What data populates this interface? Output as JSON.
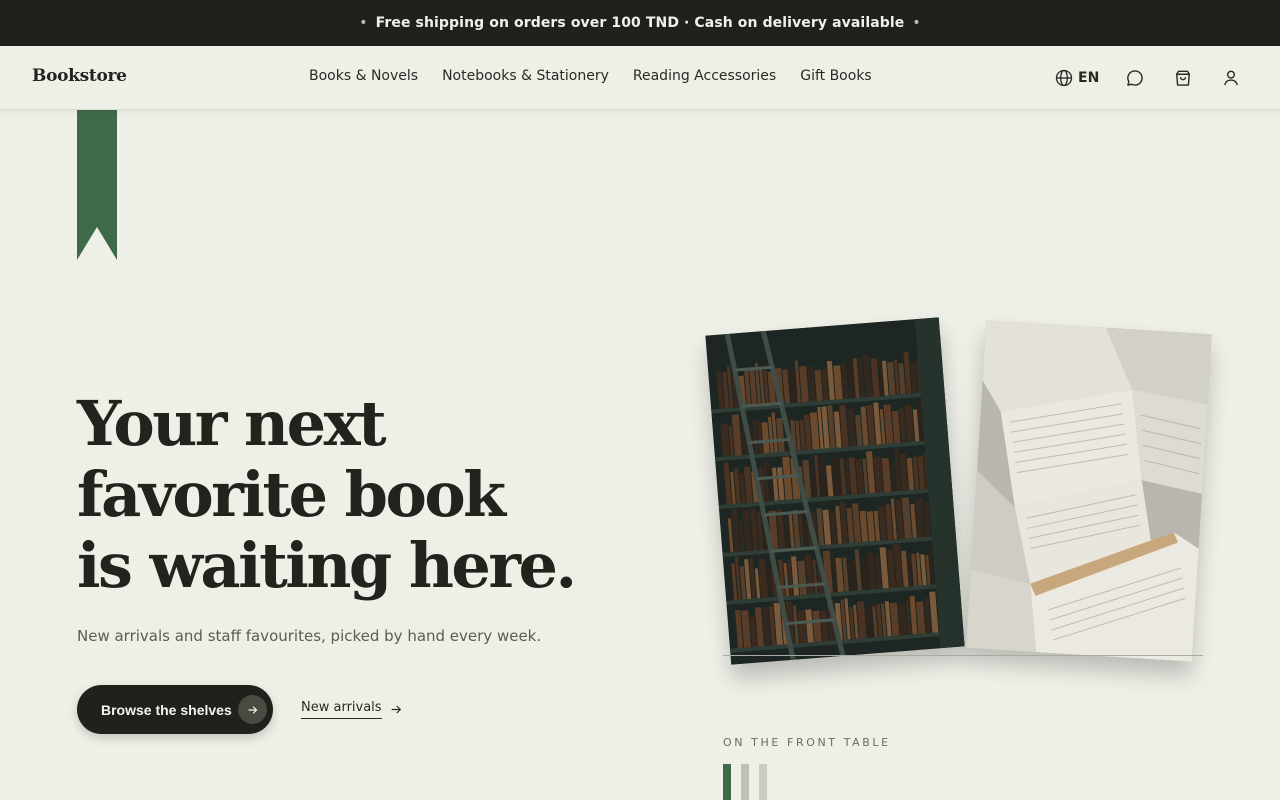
{
  "announcement": {
    "text": "Free shipping on orders over 100 TND · Cash on delivery available",
    "bullet": "•"
  },
  "nav": {
    "logo": "Bookstore",
    "items": [
      {
        "label": "Books & Novels"
      },
      {
        "label": "Notebooks & Stationery"
      },
      {
        "label": "Reading Accessories"
      },
      {
        "label": "Gift Books"
      }
    ],
    "language": "EN",
    "icons": [
      "globe-icon",
      "chat-icon",
      "shopping-bag-icon",
      "user-icon"
    ]
  },
  "hero": {
    "title_line1": "Your next",
    "title_line2": "favorite book",
    "title_line3": "is waiting here.",
    "subtitle": "New arrivals and staff favourites, picked by hand every week.",
    "primary_cta": "Browse the shelves",
    "secondary_cta": "New arrivals"
  },
  "front_table": {
    "label": "ON THE FRONT TABLE",
    "spine_colors": [
      "#3f6a4a",
      "#bfc0b7",
      "#c9cac1"
    ]
  },
  "colors": {
    "background": "#eef0e8",
    "dark": "#21211c",
    "accent_green": "#3f6a4a"
  }
}
